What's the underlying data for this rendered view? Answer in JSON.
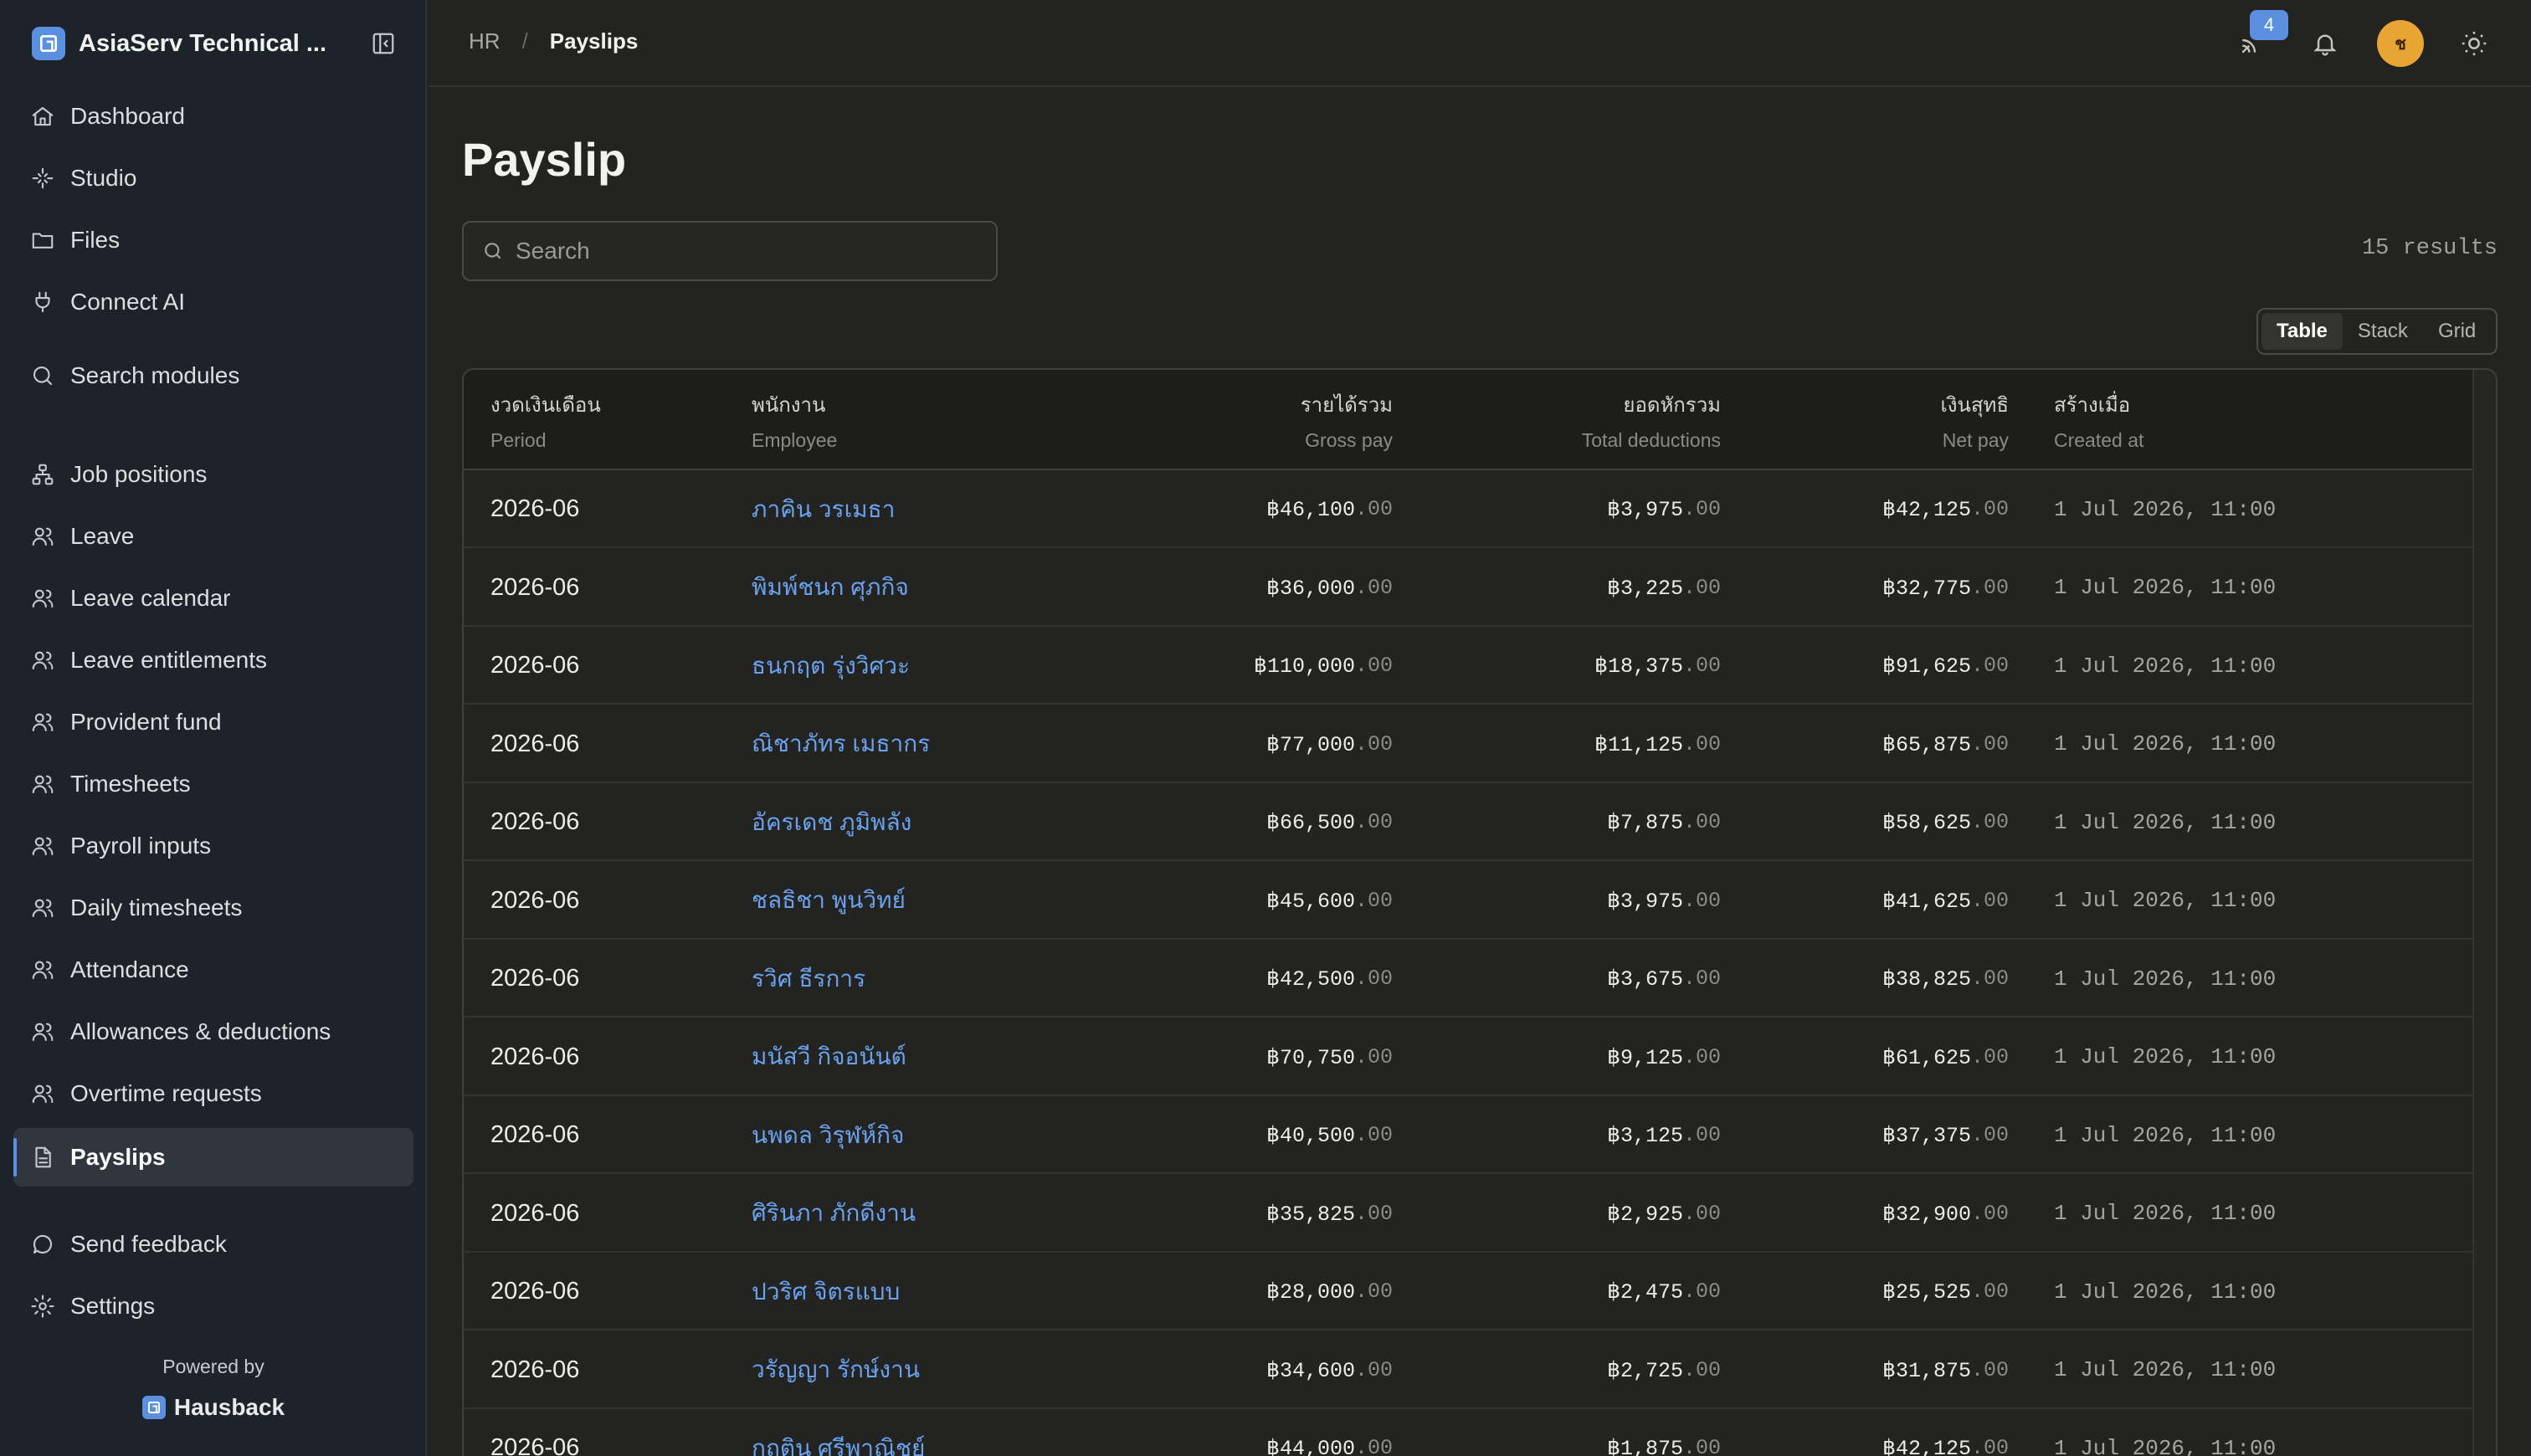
{
  "sidebar": {
    "brand": "AsiaServ Technical ...",
    "items": [
      {
        "label": "Dashboard",
        "icon": "home-icon"
      },
      {
        "label": "Studio",
        "icon": "sparkle-icon"
      },
      {
        "label": "Files",
        "icon": "folder-icon"
      },
      {
        "label": "Connect AI",
        "icon": "plug-icon"
      },
      {
        "label": "Search modules",
        "icon": "search-icon"
      },
      {
        "label": "Job positions",
        "icon": "org-chart-icon"
      },
      {
        "label": "Leave",
        "icon": "users-icon"
      },
      {
        "label": "Leave calendar",
        "icon": "users-icon"
      },
      {
        "label": "Leave entitlements",
        "icon": "users-icon"
      },
      {
        "label": "Provident fund",
        "icon": "users-icon"
      },
      {
        "label": "Timesheets",
        "icon": "users-icon"
      },
      {
        "label": "Payroll inputs",
        "icon": "users-icon"
      },
      {
        "label": "Daily timesheets",
        "icon": "users-icon"
      },
      {
        "label": "Attendance",
        "icon": "users-icon"
      },
      {
        "label": "Allowances & deductions",
        "icon": "users-icon"
      },
      {
        "label": "Overtime requests",
        "icon": "users-icon"
      },
      {
        "label": "Payslips",
        "icon": "document-icon"
      },
      {
        "label": "Send feedback",
        "icon": "chat-bubble-icon"
      },
      {
        "label": "Settings",
        "icon": "gear-icon"
      }
    ],
    "active": "Payslips",
    "powered_by": "Powered by",
    "powered_name": "Hausback"
  },
  "header": {
    "breadcrumb_parent": "HR",
    "breadcrumb_sep": "/",
    "breadcrumb_current": "Payslips",
    "notification_badge": "4",
    "avatar_initial": "ช"
  },
  "main": {
    "title": "Payslip",
    "search_placeholder": "Search",
    "results": "15 results",
    "views": [
      "Table",
      "Stack",
      "Grid"
    ],
    "selected_view": "Table"
  },
  "table": {
    "columns": [
      {
        "th": "งวดเงินเดือน",
        "en": "Period"
      },
      {
        "th": "พนักงาน",
        "en": "Employee"
      },
      {
        "th": "รายได้รวม",
        "en": "Gross pay"
      },
      {
        "th": "ยอดหักรวม",
        "en": "Total deductions"
      },
      {
        "th": "เงินสุทธิ",
        "en": "Net pay"
      },
      {
        "th": "สร้างเมื่อ",
        "en": "Created at"
      }
    ],
    "rows": [
      {
        "period": "2026-06",
        "employee": "ภาคิน วรเมธา",
        "gross": "฿46,100",
        "deductions": "฿3,975",
        "net": "฿42,125",
        "created": "1 Jul 2026, 11:00"
      },
      {
        "period": "2026-06",
        "employee": "พิมพ์ชนก ศุภกิจ",
        "gross": "฿36,000",
        "deductions": "฿3,225",
        "net": "฿32,775",
        "created": "1 Jul 2026, 11:00"
      },
      {
        "period": "2026-06",
        "employee": "ธนกฤต รุ่งวิศวะ",
        "gross": "฿110,000",
        "deductions": "฿18,375",
        "net": "฿91,625",
        "created": "1 Jul 2026, 11:00"
      },
      {
        "period": "2026-06",
        "employee": "ณิชาภัทร เมธากร",
        "gross": "฿77,000",
        "deductions": "฿11,125",
        "net": "฿65,875",
        "created": "1 Jul 2026, 11:00"
      },
      {
        "period": "2026-06",
        "employee": "อัครเดช ภูมิพลัง",
        "gross": "฿66,500",
        "deductions": "฿7,875",
        "net": "฿58,625",
        "created": "1 Jul 2026, 11:00"
      },
      {
        "period": "2026-06",
        "employee": "ชลธิชา พูนวิทย์",
        "gross": "฿45,600",
        "deductions": "฿3,975",
        "net": "฿41,625",
        "created": "1 Jul 2026, 11:00"
      },
      {
        "period": "2026-06",
        "employee": "รวิศ ธีรการ",
        "gross": "฿42,500",
        "deductions": "฿3,675",
        "net": "฿38,825",
        "created": "1 Jul 2026, 11:00"
      },
      {
        "period": "2026-06",
        "employee": "มนัสวี กิจอนันต์",
        "gross": "฿70,750",
        "deductions": "฿9,125",
        "net": "฿61,625",
        "created": "1 Jul 2026, 11:00"
      },
      {
        "period": "2026-06",
        "employee": "นพดล วิรุฬห์กิจ",
        "gross": "฿40,500",
        "deductions": "฿3,125",
        "net": "฿37,375",
        "created": "1 Jul 2026, 11:00"
      },
      {
        "period": "2026-06",
        "employee": "ศิรินภา ภักดีงาน",
        "gross": "฿35,825",
        "deductions": "฿2,925",
        "net": "฿32,900",
        "created": "1 Jul 2026, 11:00"
      },
      {
        "period": "2026-06",
        "employee": "ปวริศ จิตรแบบ",
        "gross": "฿28,000",
        "deductions": "฿2,475",
        "net": "฿25,525",
        "created": "1 Jul 2026, 11:00"
      },
      {
        "period": "2026-06",
        "employee": "วรัญญา รักษ์งาน",
        "gross": "฿34,600",
        "deductions": "฿2,725",
        "net": "฿31,875",
        "created": "1 Jul 2026, 11:00"
      },
      {
        "period": "2026-06",
        "employee": "กฤติน ศรีพาณิชย์",
        "gross": "฿44,000",
        "deductions": "฿1,875",
        "net": "฿42,125",
        "created": "1 Jul 2026, 11:00"
      }
    ],
    "decimal_suffix": ".00"
  }
}
